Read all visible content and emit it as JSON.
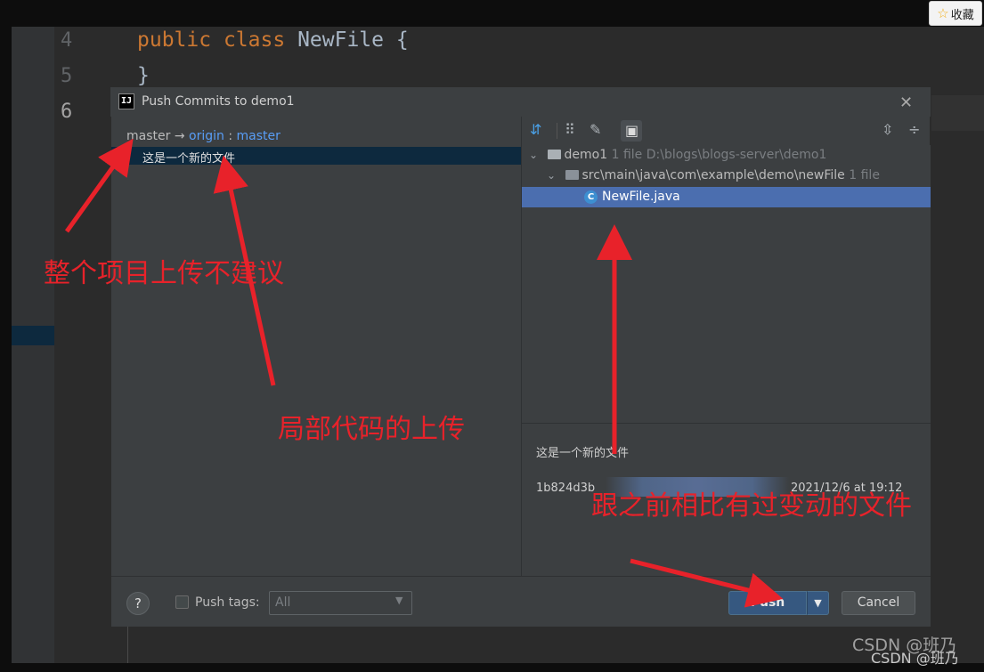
{
  "browser": {
    "favorite_label": "收藏"
  },
  "editor": {
    "line_numbers": [
      "4",
      "5",
      "6"
    ],
    "code_lines": [
      {
        "kw1": "public",
        "kw2": "class",
        "name": "NewFile",
        "brace": "{"
      },
      {
        "text": "}"
      }
    ],
    "colors": {
      "keyword": "#cc7832",
      "classname": "#a9b7c6"
    }
  },
  "dialog": {
    "app_icon_text": "IJ",
    "title": "Push Commits to demo1",
    "close_label": "✕",
    "branch": {
      "local": "master",
      "arrow": "→",
      "remote": "origin",
      "sep": ":",
      "remote_branch": "master"
    },
    "commits": [
      {
        "message": "这是一个新的文件"
      }
    ],
    "tree": {
      "root": {
        "name": "demo1",
        "count": "1 file",
        "path": "D:\\blogs\\blogs-server\\demo1"
      },
      "folder": {
        "name": "src\\main\\java\\com\\example\\demo\\newFile",
        "count": "1 file"
      },
      "file": {
        "name": "NewFile.java"
      }
    },
    "details": {
      "message": "这是一个新的文件",
      "hash": "1b824d3b",
      "date": "2021/12/6 at 19:12"
    },
    "bottom": {
      "help_label": "?",
      "push_tags_label": "Push tags:",
      "push_tags_value": "All",
      "push_label": "Push",
      "cancel_label": "Cancel"
    }
  },
  "annotations": {
    "whole_project": "整个项目上传不建议",
    "partial_code": "局部代码的上传",
    "changed_files": "跟之前相比有过变动的文件",
    "color": "#e8222a"
  },
  "watermark": {
    "line1": "CSDN @班乃",
    "line2": "CSDN @班乃"
  }
}
